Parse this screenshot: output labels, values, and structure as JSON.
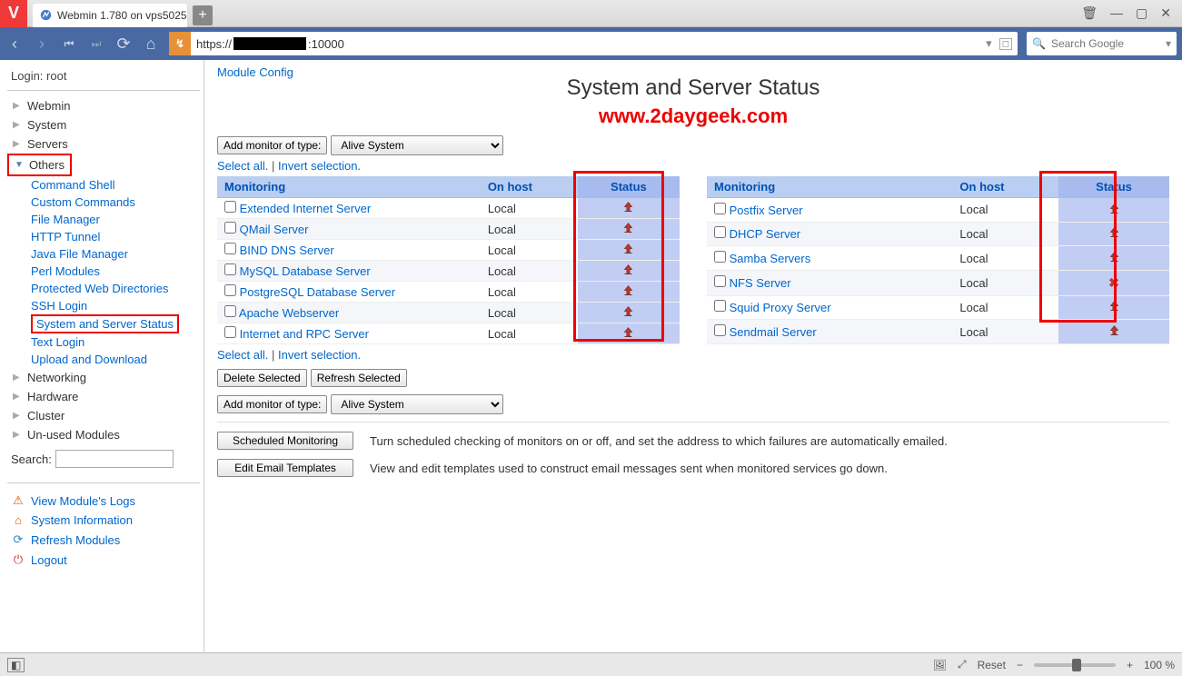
{
  "browser": {
    "tab_title": "Webmin 1.780 on vps5025",
    "url_prefix": "https://",
    "url_suffix": ":10000",
    "search_placeholder": "Search Google"
  },
  "sidebar": {
    "login_label": "Login: root",
    "sections": [
      "Webmin",
      "System",
      "Servers",
      "Others",
      "Networking",
      "Hardware",
      "Cluster",
      "Un-used Modules"
    ],
    "others_items": [
      "Command Shell",
      "Custom Commands",
      "File Manager",
      "HTTP Tunnel",
      "Java File Manager",
      "Perl Modules",
      "Protected Web Directories",
      "SSH Login",
      "System and Server Status",
      "Text Login",
      "Upload and Download"
    ],
    "search_label": "Search:",
    "links": {
      "view_logs": "View Module's Logs",
      "sys_info": "System Information",
      "refresh_mods": "Refresh Modules",
      "logout": "Logout"
    }
  },
  "page": {
    "module_config": "Module Config",
    "title": "System and Server Status",
    "watermark": "www.2daygeek.com",
    "add_monitor_label": "Add monitor of type:",
    "add_monitor_value": "Alive System",
    "select_all": "Select all.",
    "invert_sel": "Invert selection.",
    "delete_btn": "Delete Selected",
    "refresh_btn": "Refresh Selected",
    "sched_btn": "Scheduled Monitoring",
    "sched_desc": "Turn scheduled checking of monitors on or off, and set the address to which failures are automatically emailed.",
    "email_btn": "Edit Email Templates",
    "email_desc": "View and edit templates used to construct email messages sent when monitored services go down."
  },
  "table": {
    "headers": {
      "monitoring": "Monitoring",
      "on_host": "On host",
      "status": "Status"
    },
    "left": [
      {
        "name": "Extended Internet Server",
        "host": "Local",
        "status": "up"
      },
      {
        "name": "QMail Server",
        "host": "Local",
        "status": "up"
      },
      {
        "name": "BIND DNS Server",
        "host": "Local",
        "status": "up"
      },
      {
        "name": "MySQL Database Server",
        "host": "Local",
        "status": "up"
      },
      {
        "name": "PostgreSQL Database Server",
        "host": "Local",
        "status": "up"
      },
      {
        "name": "Apache Webserver",
        "host": "Local",
        "status": "up"
      },
      {
        "name": "Internet and RPC Server",
        "host": "Local",
        "status": "up"
      }
    ],
    "right": [
      {
        "name": "Postfix Server",
        "host": "Local",
        "status": "up"
      },
      {
        "name": "DHCP Server",
        "host": "Local",
        "status": "up"
      },
      {
        "name": "Samba Servers",
        "host": "Local",
        "status": "up"
      },
      {
        "name": "NFS Server",
        "host": "Local",
        "status": "down"
      },
      {
        "name": "Squid Proxy Server",
        "host": "Local",
        "status": "up"
      },
      {
        "name": "Sendmail Server",
        "host": "Local",
        "status": "up"
      }
    ]
  },
  "statusbar": {
    "reset": "Reset",
    "zoom": "100 %"
  }
}
